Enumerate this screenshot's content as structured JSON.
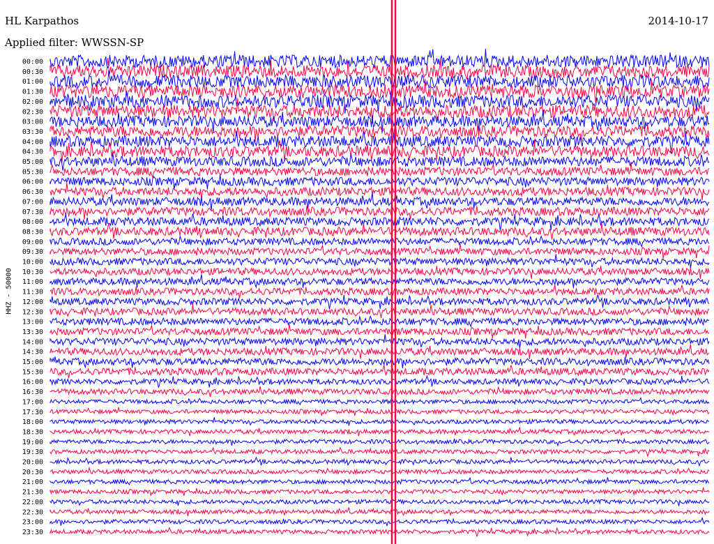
{
  "header": {
    "station": "HL Karpathos",
    "date": "2014-10-17",
    "filter": "Applied filter: WWSSN-SP"
  },
  "chart_data": {
    "type": "seismogram",
    "title": "HL Karpathos",
    "ylabel": "HHZ - 50000",
    "trace_colors": [
      "#0000ff",
      "#ff0040"
    ],
    "marker_color": "#ff0040",
    "rows": [
      "00:00",
      "00:30",
      "01:00",
      "01:30",
      "02:00",
      "02:30",
      "03:00",
      "03:30",
      "04:00",
      "04:30",
      "05:00",
      "05:30",
      "06:00",
      "06:30",
      "07:00",
      "07:30",
      "08:00",
      "08:30",
      "09:00",
      "09:30",
      "10:00",
      "10:30",
      "11:00",
      "11:30",
      "12:00",
      "12:30",
      "13:00",
      "13:30",
      "14:00",
      "14:30",
      "15:00",
      "15:30",
      "16:00",
      "16:30",
      "17:00",
      "17:30",
      "18:00",
      "18:30",
      "19:00",
      "19:30",
      "20:00",
      "20:30",
      "21:00",
      "21:30",
      "22:00",
      "22:30",
      "23:00",
      "23:30"
    ],
    "row_amplitude": [
      9,
      9,
      9,
      9,
      9,
      9,
      8,
      8,
      8,
      8,
      7,
      6,
      6,
      6,
      6,
      6,
      6,
      6,
      5,
      5,
      5,
      5,
      5,
      5,
      5,
      5,
      5,
      5,
      5,
      5,
      5,
      5,
      4,
      4,
      3,
      3,
      3,
      3,
      3,
      3,
      3,
      3,
      3,
      3,
      3,
      3,
      3,
      3
    ]
  }
}
